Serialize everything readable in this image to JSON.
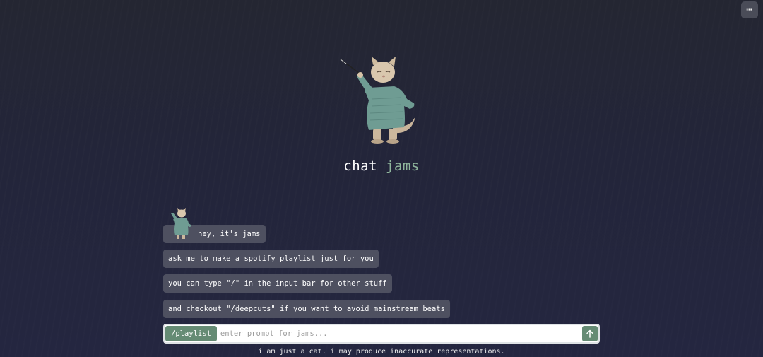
{
  "header": {
    "menu_icon": "ellipsis-icon",
    "menu_glyph": "⋯"
  },
  "hero": {
    "title_part1": "chat",
    "title_part2": "jams",
    "accent_color": "#8fb59c",
    "image": "conductor-cat-illustration"
  },
  "chat": {
    "avatar": "conductor-cat-avatar",
    "messages": [
      "hey, it's jams",
      "ask me to make a spotify playlist just for you",
      "you can type \"/\" in the input bar for other stuff",
      "and checkout \"/deepcuts\" if you want to avoid mainstream beats"
    ]
  },
  "composer": {
    "command_chip": "/playlist",
    "placeholder": "enter prompt for jams...",
    "value": "",
    "send_icon": "arrow-up-icon"
  },
  "footer": {
    "disclaimer": "i am just a cat. i may produce inaccurate representations."
  },
  "colors": {
    "bubble_bg": "#4e5060",
    "button_green": "#658b74",
    "page_bg": "#242632"
  }
}
